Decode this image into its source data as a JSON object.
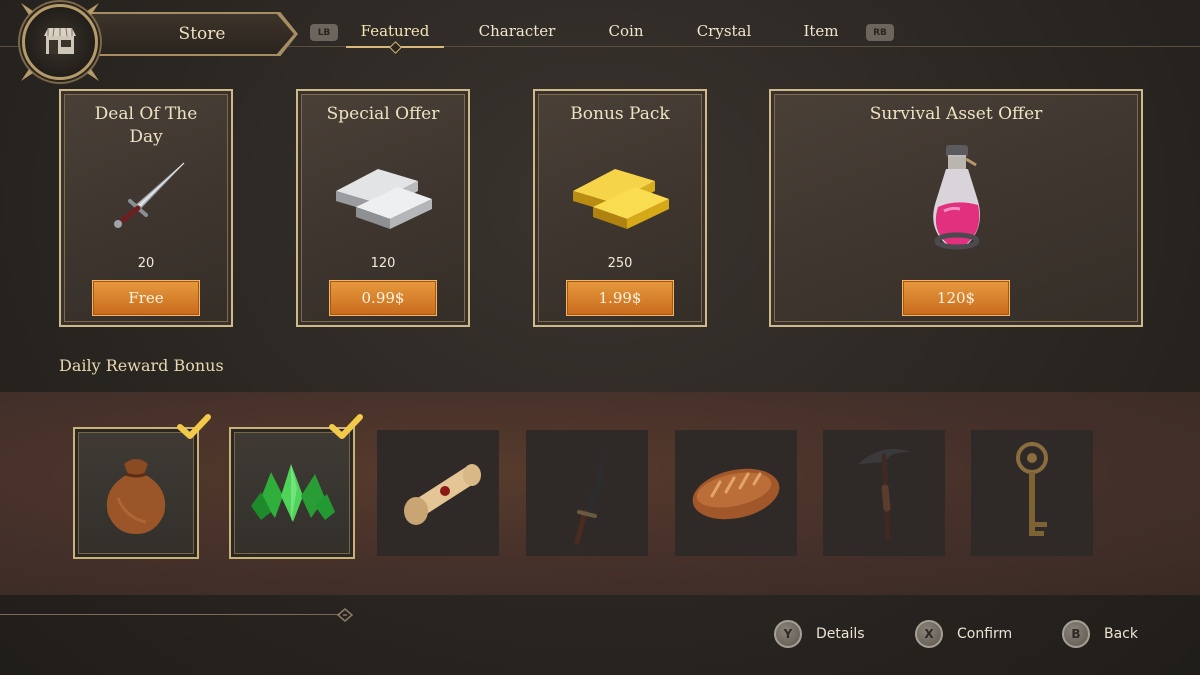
{
  "header": {
    "store_label": "Store",
    "lb_label": "LB",
    "rb_label": "RB",
    "tabs": [
      {
        "label": "Featured",
        "active": true
      },
      {
        "label": "Character",
        "active": false
      },
      {
        "label": "Coin",
        "active": false
      },
      {
        "label": "Crystal",
        "active": false
      },
      {
        "label": "Item",
        "active": false
      }
    ]
  },
  "offers": [
    {
      "title": "Deal Of The Day",
      "amount": "20",
      "price": "Free",
      "icon": "dagger-icon"
    },
    {
      "title": "Special Offer",
      "amount": "120",
      "price": "0.99$",
      "icon": "silver-bars-icon"
    },
    {
      "title": "Bonus Pack",
      "amount": "250",
      "price": "1.99$",
      "icon": "gold-bars-icon"
    },
    {
      "title": "Survival Asset Offer",
      "amount": "",
      "price": "120$",
      "icon": "potion-icon"
    }
  ],
  "daily": {
    "title": "Daily Reward Bonus",
    "rewards": [
      {
        "icon": "coin-pouch-icon",
        "claimed": true
      },
      {
        "icon": "green-crystals-icon",
        "claimed": true
      },
      {
        "icon": "scroll-icon",
        "claimed": false
      },
      {
        "icon": "scimitar-icon",
        "claimed": false
      },
      {
        "icon": "bread-icon",
        "claimed": false
      },
      {
        "icon": "pickaxe-icon",
        "claimed": false
      },
      {
        "icon": "key-icon",
        "claimed": false
      }
    ]
  },
  "footer": {
    "hints": [
      {
        "button": "Y",
        "label": "Details"
      },
      {
        "button": "X",
        "label": "Confirm"
      },
      {
        "button": "B",
        "label": "Back"
      }
    ]
  },
  "colors": {
    "accent_gold": "#cdb98a",
    "price_orange": "#d9822d",
    "check_yellow": "#f3c94a"
  }
}
